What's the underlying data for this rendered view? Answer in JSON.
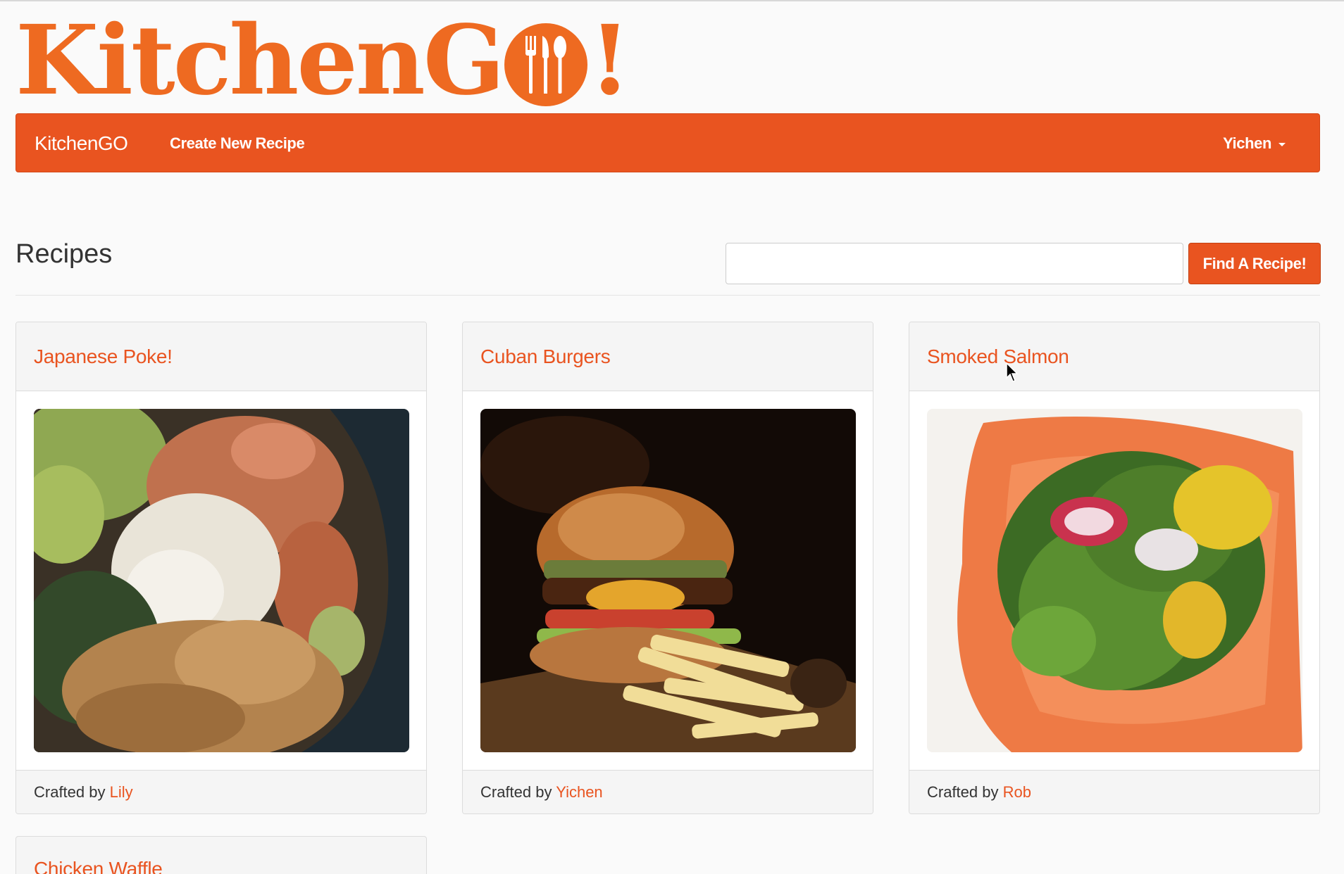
{
  "logo": {
    "text_main": "KitchenG",
    "text_end": "!",
    "o_icon": "fork-knife-spoon-icon"
  },
  "navbar": {
    "brand": "KitchenGO",
    "create_link": "Create New Recipe",
    "user": "Yichen",
    "user_menu_icon": "caret-down-icon"
  },
  "page": {
    "title": "Recipes"
  },
  "search": {
    "value": "",
    "button": "Find A Recipe!"
  },
  "colors": {
    "brand": "#e95420",
    "logo": "#ee6a21"
  },
  "recipes": [
    {
      "title": "Japanese Poke!",
      "crafted_by": "Crafted by",
      "author": "Lily"
    },
    {
      "title": "Cuban Burgers",
      "crafted_by": "Crafted by",
      "author": "Yichen"
    },
    {
      "title": "Smoked Salmon",
      "crafted_by": "Crafted by",
      "author": "Rob"
    },
    {
      "title": "Chicken Waffle"
    }
  ]
}
